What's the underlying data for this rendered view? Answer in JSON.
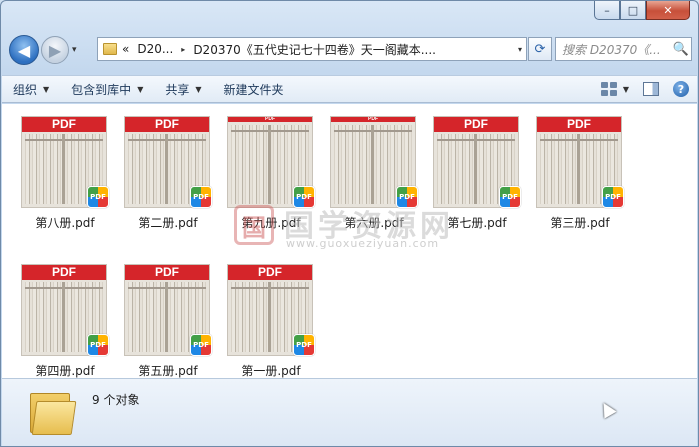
{
  "window": {
    "caption_buttons": {
      "minimize": "–",
      "maximize": "□",
      "close": "✕"
    }
  },
  "nav": {
    "back_glyph": "◀",
    "forward_glyph": "▶",
    "recent_glyph": "▾",
    "address": {
      "overflow": "«",
      "seg1": "D20...",
      "seg2": "D20370《五代史记七十四卷》天一阁藏本....",
      "separator": "▸",
      "dropdown": "▾"
    },
    "refresh_glyph": "⟳",
    "search": {
      "placeholder": "搜索 D20370《...",
      "icon": "🔍"
    }
  },
  "toolbar": {
    "organize": "组织",
    "include_in_library": "包含到库中",
    "share": "共享",
    "new_folder": "新建文件夹",
    "caret": "▼",
    "help": "?"
  },
  "files": [
    {
      "name": "第八册.pdf",
      "banner": "PDF"
    },
    {
      "name": "第二册.pdf",
      "banner": "PDF"
    },
    {
      "name": "第九册.pdf",
      "banner": "PDF"
    },
    {
      "name": "第六册.pdf",
      "banner": "PDF"
    },
    {
      "name": "第七册.pdf",
      "banner": "PDF"
    },
    {
      "name": "第三册.pdf",
      "banner": "PDF"
    },
    {
      "name": "第四册.pdf",
      "banner": "PDF"
    },
    {
      "name": "第五册.pdf",
      "banner": "PDF"
    },
    {
      "name": "第一册.pdf",
      "banner": "PDF"
    }
  ],
  "badge_text": "PDF",
  "watermark": {
    "seal": "国",
    "text": "国学资源网",
    "url": "www.guoxueziyuan.com"
  },
  "status": {
    "count": "9 个对象"
  }
}
